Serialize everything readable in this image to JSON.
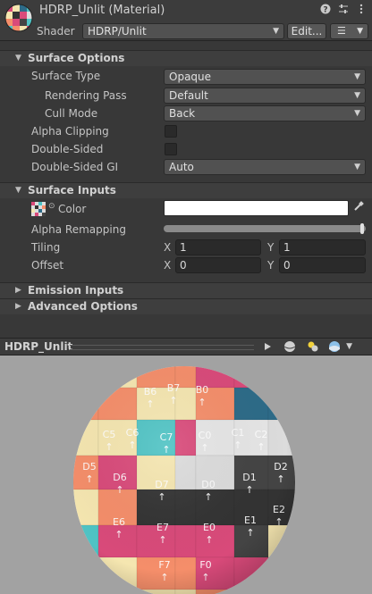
{
  "header": {
    "title": "HDRP_Unlit (Material)",
    "shader_label": "Shader",
    "shader_value": "HDRP/Unlit",
    "edit_label": "Edit...",
    "icons": [
      "help-icon",
      "settings-sliders-icon",
      "more-options-icon",
      "list-icon"
    ]
  },
  "surface_options": {
    "title": "Surface Options",
    "surface_type": {
      "label": "Surface Type",
      "value": "Opaque"
    },
    "rendering_pass": {
      "label": "Rendering Pass",
      "value": "Default"
    },
    "cull_mode": {
      "label": "Cull Mode",
      "value": "Back"
    },
    "alpha_clipping": {
      "label": "Alpha Clipping",
      "checked": false
    },
    "double_sided": {
      "label": "Double-Sided",
      "checked": false
    },
    "double_sided_gi": {
      "label": "Double-Sided GI",
      "value": "Auto"
    }
  },
  "surface_inputs": {
    "title": "Surface Inputs",
    "color": {
      "label": "Color",
      "value": "#FFFFFF"
    },
    "alpha_remapping": {
      "label": "Alpha Remapping"
    },
    "tiling": {
      "label": "Tiling",
      "x_label": "X",
      "x": "1",
      "y_label": "Y",
      "y": "1"
    },
    "offset": {
      "label": "Offset",
      "x_label": "X",
      "x": "0",
      "y_label": "Y",
      "y": "0"
    }
  },
  "collapsed_sections": {
    "emission": "Emission Inputs",
    "advanced": "Advanced Options"
  },
  "preview": {
    "title": "HDRP_Unlit",
    "sphere_labels": [
      "B6",
      "B7",
      "B0",
      "C5",
      "C6",
      "C7",
      "C0",
      "C1",
      "C2",
      "D5",
      "D6",
      "D7",
      "D0",
      "D1",
      "D2",
      "E6",
      "E7",
      "E0",
      "E1",
      "E2",
      "F7",
      "F0"
    ]
  },
  "colors": {
    "panel": "#383838",
    "header": "#3c3c3c",
    "field": "#2a2a2a",
    "dropdown": "#515151",
    "preview_bg": "#a2a2a2"
  }
}
